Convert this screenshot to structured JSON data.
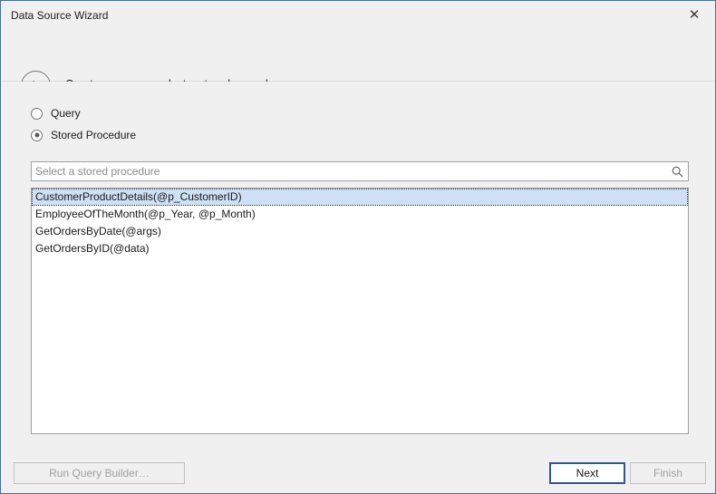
{
  "window": {
    "title": "Data Source Wizard",
    "close_label": "✕",
    "border_color": "#4a6fa5"
  },
  "header": {
    "back_label": "back-arrow",
    "title": "Create a query or select a stored procedure."
  },
  "options": {
    "query": {
      "label": "Query",
      "selected": false
    },
    "stored_procedure": {
      "label": "Stored Procedure",
      "selected": true
    }
  },
  "search": {
    "placeholder": "Select a stored procedure",
    "value": "",
    "icon": "search-icon"
  },
  "list": {
    "items": [
      {
        "label": "CustomerProductDetails(@p_CustomerID)",
        "selected": true
      },
      {
        "label": "EmployeeOfTheMonth(@p_Year, @p_Month)",
        "selected": false
      },
      {
        "label": "GetOrdersByDate(@args)",
        "selected": false
      },
      {
        "label": "GetOrdersByID(@data)",
        "selected": false
      }
    ],
    "selection_color": "#cde0f5"
  },
  "footer": {
    "run_query_builder": {
      "label": "Run Query Builder…",
      "enabled": false
    },
    "next": {
      "label": "Next",
      "enabled": true,
      "is_default": true
    },
    "finish": {
      "label": "Finish",
      "enabled": false
    }
  }
}
